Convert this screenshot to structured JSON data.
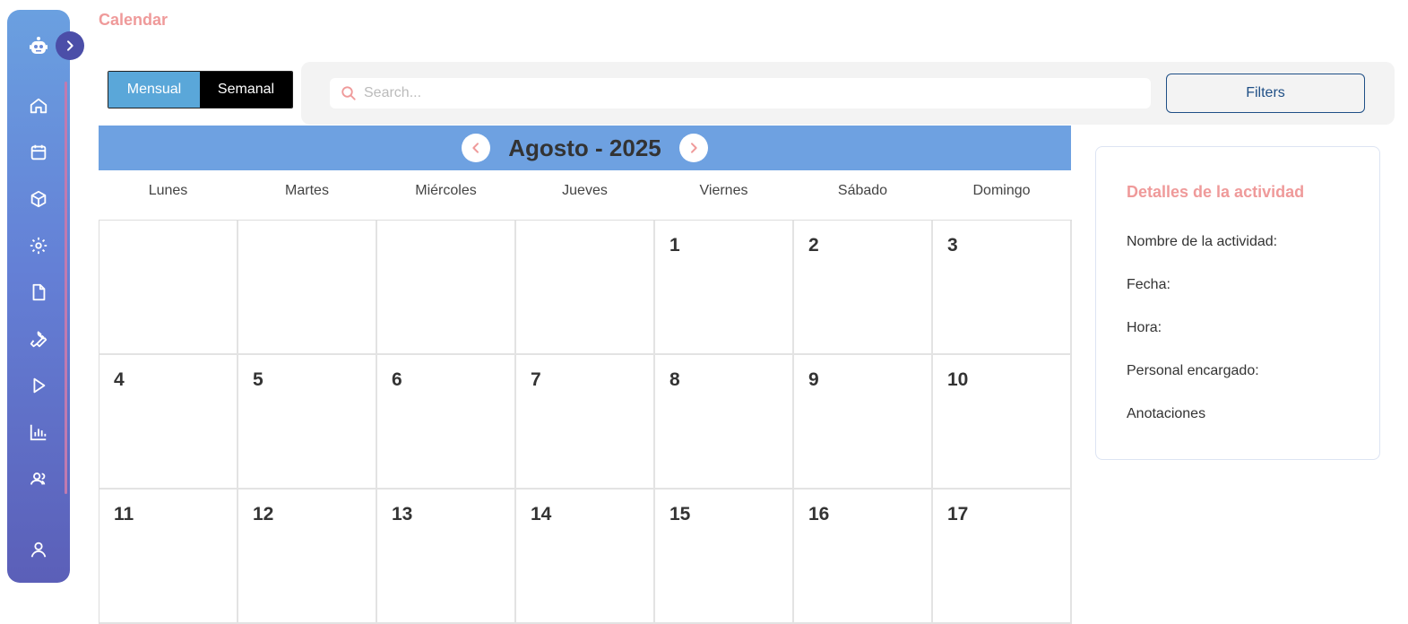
{
  "page": {
    "title": "Calendar"
  },
  "sidebar": {
    "items": [
      {
        "name": "home-icon"
      },
      {
        "name": "calendar-icon"
      },
      {
        "name": "box-icon"
      },
      {
        "name": "gear-icon"
      },
      {
        "name": "file-icon"
      },
      {
        "name": "wrench-icon"
      },
      {
        "name": "play-icon"
      },
      {
        "name": "bar-chart-icon"
      },
      {
        "name": "users-icon"
      },
      {
        "name": "user-icon"
      }
    ],
    "colors": {
      "top": "#6aa0e0",
      "bottom": "#5b5fb8"
    }
  },
  "view_toggle": {
    "monthly": "Mensual",
    "weekly": "Semanal"
  },
  "search": {
    "placeholder": "Search..."
  },
  "filters": {
    "label": "Filters"
  },
  "calendar": {
    "month_label": "Agosto - 2025",
    "weekdays": [
      "Lunes",
      "Martes",
      "Miércoles",
      "Jueves",
      "Viernes",
      "Sábado",
      "Domingo"
    ],
    "days": [
      "",
      "",
      "",
      "",
      "1",
      "2",
      "3",
      "4",
      "5",
      "6",
      "7",
      "8",
      "9",
      "10",
      "11",
      "12",
      "13",
      "14",
      "15",
      "16",
      "17"
    ]
  },
  "details": {
    "title": "Detalles de la actividad",
    "fields": [
      "Nombre de la actividad:",
      "Fecha:",
      "Hora:",
      "Personal encargado:",
      "Anotaciones"
    ]
  },
  "colors": {
    "accent_pink": "#ef9a9a",
    "header_blue": "#6ea1e1",
    "toggle_active": "#5aa7d9"
  }
}
